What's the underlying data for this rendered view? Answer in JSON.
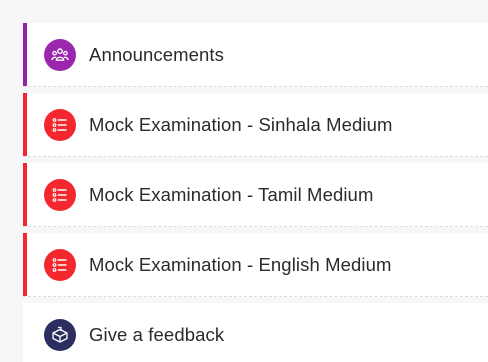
{
  "items": [
    {
      "label": "Announcements",
      "icon": "people-group-icon",
      "accent_color": "#8e24aa",
      "icon_bg": "#9b27af"
    },
    {
      "label": "Mock Examination - Sinhala Medium",
      "icon": "list-icon",
      "accent_color": "#f4272f",
      "icon_bg": "#f4272f"
    },
    {
      "label": "Mock Examination - Tamil Medium",
      "icon": "list-icon",
      "accent_color": "#f4272f",
      "icon_bg": "#f4272f"
    },
    {
      "label": "Mock Examination - English Medium",
      "icon": "list-icon",
      "accent_color": "#f4272f",
      "icon_bg": "#f4272f"
    },
    {
      "label": "Give a feedback",
      "icon": "feedback-box-icon",
      "accent_color": "",
      "icon_bg": "#2b2e5e"
    }
  ]
}
